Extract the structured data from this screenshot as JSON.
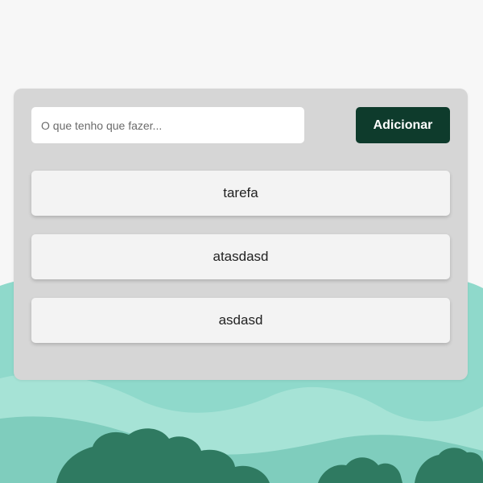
{
  "form": {
    "input_placeholder": "O que tenho que fazer...",
    "add_label": "Adicionar"
  },
  "tasks": [
    {
      "label": "tarefa"
    },
    {
      "label": "atasdasd"
    },
    {
      "label": "asdasd"
    }
  ],
  "colors": {
    "background": "#f7f7f7",
    "card": "#d6d6d6",
    "button": "#0e3b2c",
    "task_item": "#f3f3f3",
    "hills_light": "#9ddfd3",
    "hills_mid": "#6cc3b2",
    "trees": "#2f7a61"
  }
}
